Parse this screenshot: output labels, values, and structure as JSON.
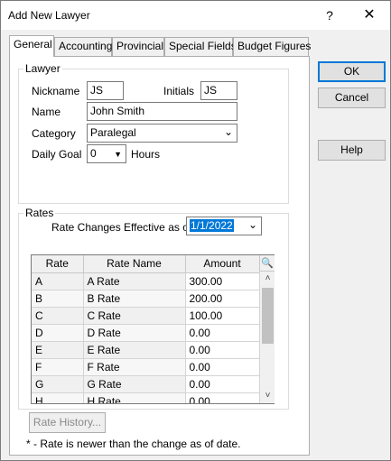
{
  "window": {
    "title": "Add New Lawyer",
    "help_glyph": "?",
    "close_glyph": "✕"
  },
  "tabs": [
    {
      "label": "General",
      "active": true
    },
    {
      "label": "Accounting"
    },
    {
      "label": "Provincial"
    },
    {
      "label": "Special Fields"
    },
    {
      "label": "Budget Figures"
    }
  ],
  "lawyer": {
    "legend": "Lawyer",
    "nickname_label": "Nickname",
    "nickname_value": "JS",
    "initials_label": "Initials",
    "initials_value": "JS",
    "name_label": "Name",
    "name_value": "John Smith",
    "category_label": "Category",
    "category_value": "Paralegal",
    "daily_goal_label": "Daily Goal",
    "daily_goal_value": "0",
    "hours_label": "Hours"
  },
  "rates": {
    "legend": "Rates",
    "effective_label": "Rate Changes Effective as of:",
    "effective_value": "1/1/2022",
    "columns": [
      "Rate",
      "Rate Name",
      "Amount"
    ],
    "rows": [
      {
        "rate": "A",
        "name": "A Rate",
        "amount": "300.00"
      },
      {
        "rate": "B",
        "name": "B Rate",
        "amount": "200.00"
      },
      {
        "rate": "C",
        "name": "C Rate",
        "amount": "100.00"
      },
      {
        "rate": "D",
        "name": "D Rate",
        "amount": "0.00"
      },
      {
        "rate": "E",
        "name": "E Rate",
        "amount": "0.00"
      },
      {
        "rate": "F",
        "name": "F Rate",
        "amount": "0.00"
      },
      {
        "rate": "G",
        "name": "G Rate",
        "amount": "0.00"
      },
      {
        "rate": "H",
        "name": "H Rate",
        "amount": "0.00"
      }
    ],
    "history_button": "Rate History...",
    "footnote": "* - Rate is newer than the change as of date."
  },
  "buttons": {
    "ok": "OK",
    "cancel": "Cancel",
    "help": "Help"
  },
  "colors": {
    "selection": "#0078d7",
    "default_border": "#0078d7"
  }
}
